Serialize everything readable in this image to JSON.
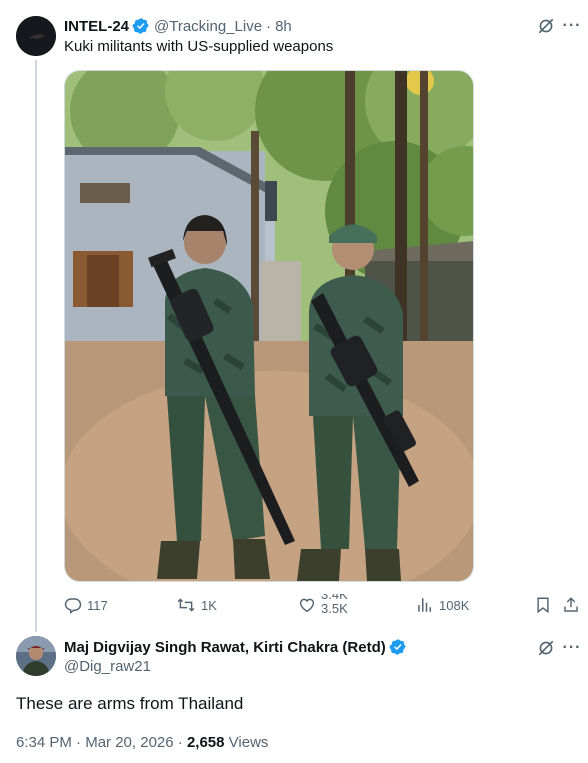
{
  "tweet1": {
    "author_name": "INTEL-24",
    "handle": "@Tracking_Live",
    "time": "8h",
    "text": "Kuki militants with US-supplied weapons",
    "stats": {
      "replies": "117",
      "reposts": "1K",
      "likes_top": "3.4K",
      "likes_bottom": "3.5K",
      "views": "108K"
    }
  },
  "tweet2": {
    "author_name": "Maj Digvijay Singh Rawat, Kirti Chakra (Retd)",
    "handle": "@Dig_raw21",
    "text": "These are arms from Thailand",
    "timestamp": "6:34 PM",
    "date": "Mar 20, 2026",
    "views_count": "2,658",
    "views_label": "Views"
  },
  "separators": {
    "dot": "·"
  },
  "icons": {
    "verified": "verified-badge-icon",
    "grok": "grok-icon",
    "more": "more-icon",
    "reply": "reply-icon",
    "repost": "repost-icon",
    "like": "like-icon",
    "views": "views-icon",
    "bookmark": "bookmark-icon",
    "share": "share-icon"
  },
  "colors": {
    "verified": "#1d9bf0",
    "muted": "#536471",
    "text": "#0f1419",
    "line": "#cfd9de"
  }
}
